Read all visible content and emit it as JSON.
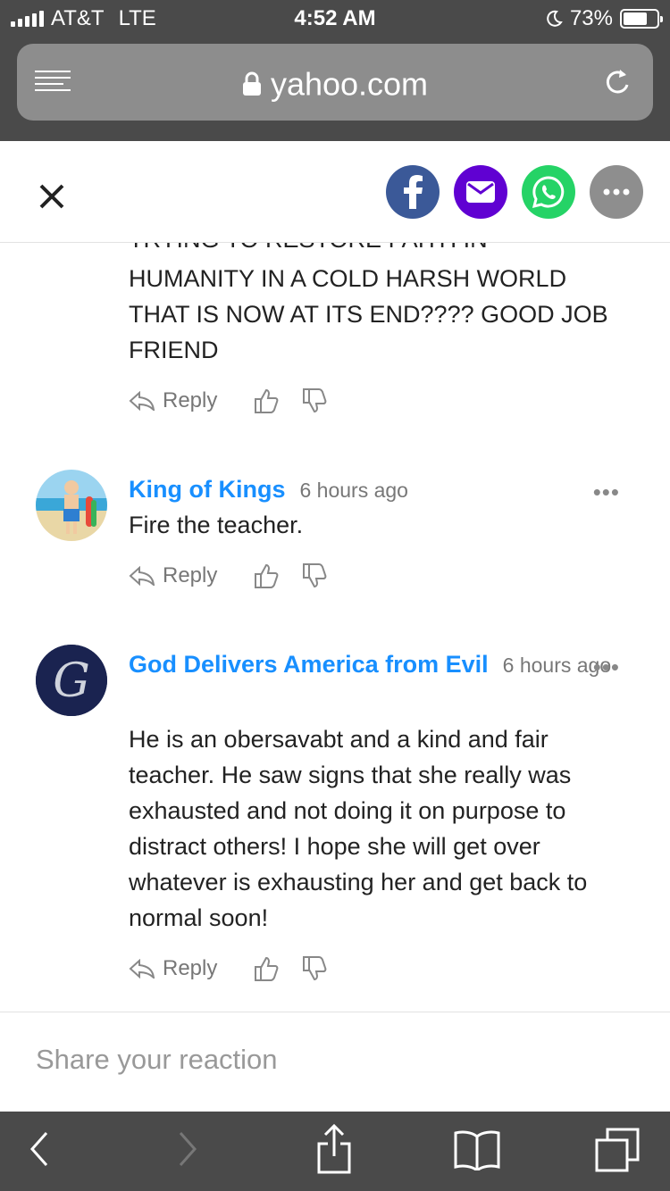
{
  "status": {
    "carrier": "AT&T",
    "network": "LTE",
    "time": "4:52 AM",
    "battery": "73%",
    "battery_level": 0.73
  },
  "browser": {
    "domain": "yahoo.com"
  },
  "share": {
    "icons": [
      "facebook-icon",
      "mail-icon",
      "whatsapp-icon",
      "more-icon"
    ],
    "colors": {
      "facebook": "#3b5998",
      "mail": "#6001d2",
      "whatsapp": "#25d366",
      "more": "#8e8e8e"
    }
  },
  "comments": [
    {
      "body_partial_top": "TRYING TO RESTORE FAITH IN",
      "body": "HUMANITY IN A COLD HARSH WORLD THAT IS NOW AT ITS END???? GOOD JOB FRIEND",
      "reply_label": "Reply"
    },
    {
      "name": "King of Kings",
      "time": "6 hours ago",
      "body": "Fire the teacher.",
      "reply_label": "Reply"
    },
    {
      "name": "God Delivers America from Evil",
      "time": "6 hours ago",
      "body": "He is an obersavabt and a kind and fair teacher. He saw signs that she really was exhausted and not doing it on purpose to distract others! I hope she will get over whatever is exhausting her and get back to normal soon!",
      "reply_label": "Reply"
    }
  ],
  "more_label": "•••",
  "reaction": {
    "placeholder": "Share your reaction"
  }
}
